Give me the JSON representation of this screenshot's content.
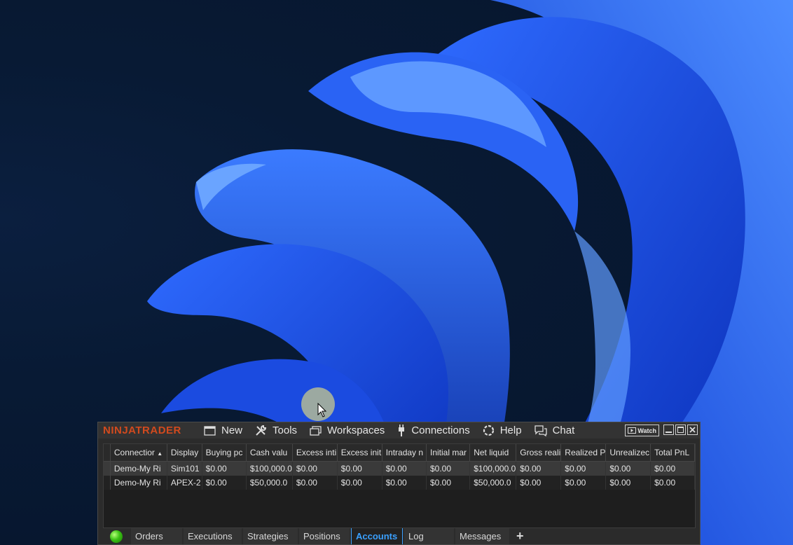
{
  "colors": {
    "brand": "#d24a1e",
    "active_tab": "#3aa0ff",
    "status": "#3bc214"
  },
  "app": {
    "logo": "NINJATRADER",
    "menu": [
      {
        "label": "New",
        "icon": "new-window-icon"
      },
      {
        "label": "Tools",
        "icon": "tools-icon"
      },
      {
        "label": "Workspaces",
        "icon": "workspaces-icon"
      },
      {
        "label": "Connections",
        "icon": "plug-icon"
      },
      {
        "label": "Help",
        "icon": "help-icon"
      },
      {
        "label": "Chat",
        "icon": "chat-icon"
      }
    ],
    "watch_label": "Watch"
  },
  "table": {
    "columns": [
      "Connectior",
      "Display",
      "Buying pc",
      "Cash valu",
      "Excess inti",
      "Excess init",
      "Intraday n",
      "Initial mar",
      "Net liquid",
      "Gross reali",
      "Realized P",
      "Unrealizec",
      "Total PnL"
    ],
    "sort_indicator": "▲",
    "rows": [
      [
        "Demo-My Ri",
        "Sim101",
        "$0.00",
        "$100,000.0",
        "$0.00",
        "$0.00",
        "$0.00",
        "$0.00",
        "$100,000.0",
        "$0.00",
        "$0.00",
        "$0.00",
        "$0.00"
      ],
      [
        "Demo-My Ri",
        "APEX-2",
        "$0.00",
        "$50,000.0",
        "$0.00",
        "$0.00",
        "$0.00",
        "$0.00",
        "$50,000.0",
        "$0.00",
        "$0.00",
        "$0.00",
        "$0.00"
      ]
    ]
  },
  "tabs": [
    {
      "label": "Orders",
      "active": false
    },
    {
      "label": "Executions",
      "active": false
    },
    {
      "label": "Strategies",
      "active": false
    },
    {
      "label": "Positions",
      "active": false
    },
    {
      "label": "Accounts",
      "active": true
    },
    {
      "label": "Log",
      "active": false
    },
    {
      "label": "Messages",
      "active": false
    }
  ],
  "add_tab": "+"
}
